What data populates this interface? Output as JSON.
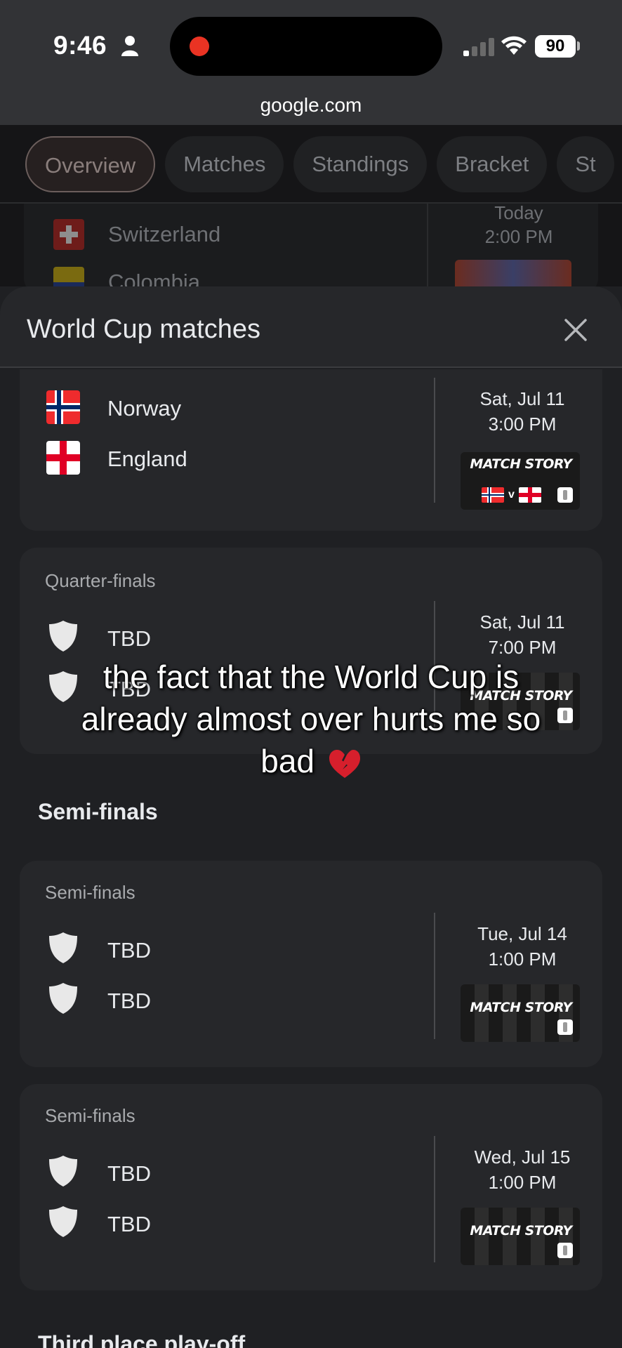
{
  "status_bar": {
    "time": "9:46",
    "battery": "90"
  },
  "browser": {
    "url": "google.com"
  },
  "background_page": {
    "tabs": [
      "Overview",
      "Matches",
      "Standings",
      "Bracket",
      "St"
    ],
    "partial_match": {
      "team1": "Switzerland",
      "team2": "Colombia",
      "date": "Today",
      "time": "2:00 PM"
    }
  },
  "sheet": {
    "title": "World Cup matches",
    "matches": [
      {
        "round": "",
        "team1": "Norway",
        "team2": "England",
        "date": "Sat, Jul 11",
        "time": "3:00 PM",
        "story": "MATCH STORY"
      },
      {
        "round": "Quarter-finals",
        "team1": "TBD",
        "team2": "TBD",
        "date": "Sat, Jul 11",
        "time": "7:00 PM",
        "story": "MATCH STORY"
      },
      {
        "round": "Semi-finals",
        "team1": "TBD",
        "team2": "TBD",
        "date": "Tue, Jul 14",
        "time": "1:00 PM",
        "story": "MATCH STORY"
      },
      {
        "round": "Semi-finals",
        "team1": "TBD",
        "team2": "TBD",
        "date": "Wed, Jul 15",
        "time": "1:00 PM",
        "story": "MATCH STORY"
      }
    ],
    "section_semis": "Semi-finals",
    "section_third": "Third place play-off"
  },
  "caption": {
    "text": "the fact that the World Cup is already almost over hurts me so bad"
  },
  "colors": {
    "accent_red": "#ea3323",
    "sheet_bg": "#1f2023",
    "card_bg": "#26272a"
  }
}
